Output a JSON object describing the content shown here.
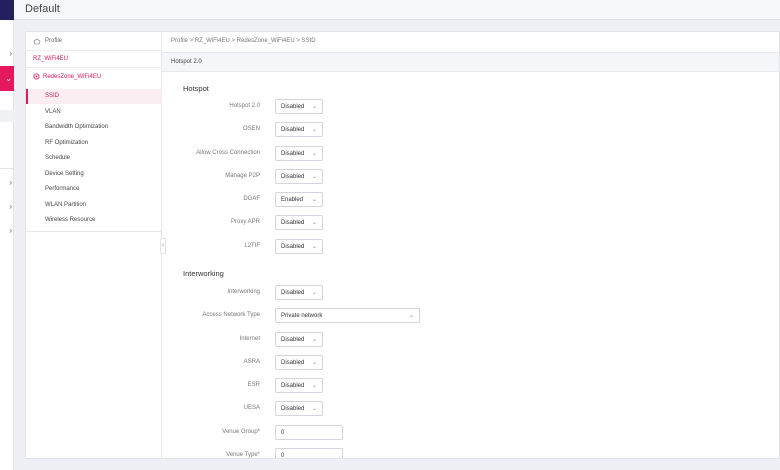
{
  "header": {
    "title": "Default"
  },
  "breadcrumb": "Profile  >  RZ_WiFi4EU  >  RedesZone_WiFi4EU  >  SSID",
  "tree": {
    "profile_label": "Profile",
    "rz_label": "RZ_WiFi4EU",
    "redes_label": "RedesZone_WiFi4EU",
    "items": [
      {
        "label": "SSID",
        "active": true
      },
      {
        "label": "VLAN"
      },
      {
        "label": "Bandwidth Optimization"
      },
      {
        "label": "RF Optimization"
      },
      {
        "label": "Schedule"
      },
      {
        "label": "Device Setting"
      },
      {
        "label": "Performance"
      },
      {
        "label": "WLAN Partition"
      },
      {
        "label": "Wireless Resource"
      }
    ]
  },
  "tab": {
    "label": "Hotspot 2.0"
  },
  "hotspot": {
    "title": "Hotspot",
    "fields": [
      {
        "label": "Hotspot 2.0",
        "value": "Disabled"
      },
      {
        "label": "OSEN",
        "value": "Disabled"
      },
      {
        "label": "Allow Cross Connection",
        "value": "Disabled"
      },
      {
        "label": "Manage P2P",
        "value": "Disabled"
      },
      {
        "label": "DGAF",
        "value": "Enabled"
      },
      {
        "label": "Proxy APR",
        "value": "Disabled"
      },
      {
        "label": "L2TIF",
        "value": "Disabled"
      }
    ]
  },
  "interworking": {
    "title": "Interworking",
    "fields": [
      {
        "label": "Interworking",
        "value": "Disabled"
      },
      {
        "label": "Access Network Type",
        "value": "Private network"
      },
      {
        "label": "Internet",
        "value": "Disabled"
      },
      {
        "label": "ASRA",
        "value": "Disabled"
      },
      {
        "label": "ESR",
        "value": "Disabled"
      },
      {
        "label": "UESA",
        "value": "Disabled"
      },
      {
        "label": "Venue Group*",
        "value": "0"
      },
      {
        "label": "Venue Type*",
        "value": "0"
      }
    ]
  }
}
